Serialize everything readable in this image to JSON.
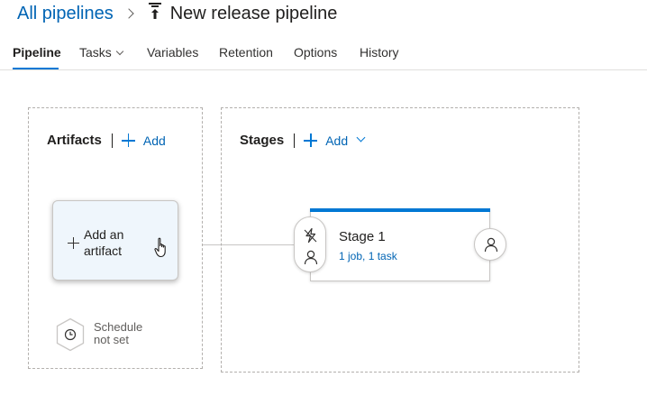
{
  "breadcrumb": {
    "root": "All pipelines",
    "title": "New release pipeline"
  },
  "tabs": [
    {
      "label": "Pipeline",
      "active": true
    },
    {
      "label": "Tasks",
      "has_dropdown": true
    },
    {
      "label": "Variables"
    },
    {
      "label": "Retention"
    },
    {
      "label": "Options"
    },
    {
      "label": "History"
    }
  ],
  "artifacts": {
    "title": "Artifacts",
    "add_label": "Add",
    "card_label": "Add an artifact",
    "schedule": "Schedule not set"
  },
  "stages": {
    "title": "Stages",
    "add_label": "Add",
    "items": [
      {
        "name": "Stage 1",
        "summary": "1 job, 1 task"
      }
    ]
  },
  "colors": {
    "accent": "#0078d4",
    "link": "#0064b4",
    "artifact_card_bg": "#eff6fc"
  }
}
